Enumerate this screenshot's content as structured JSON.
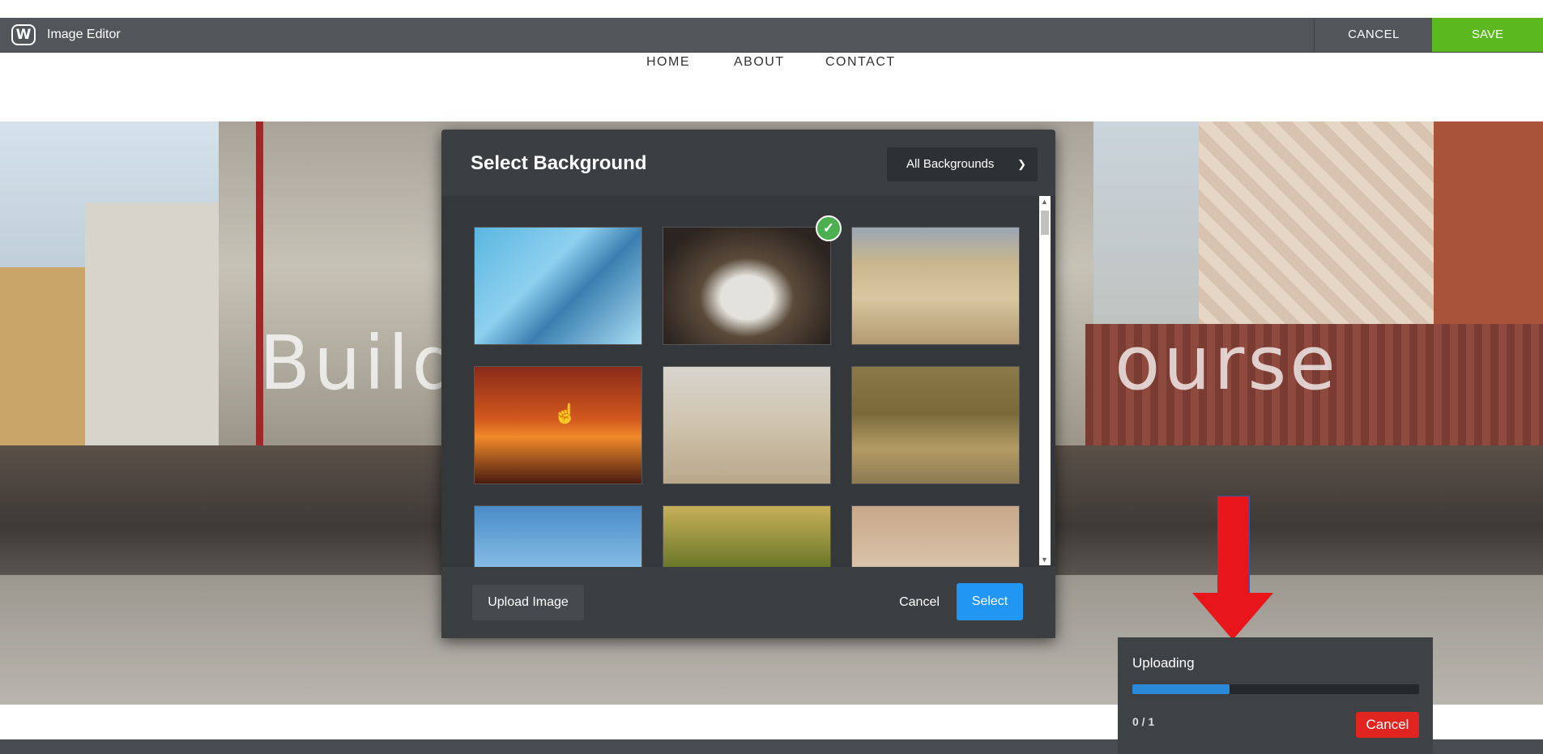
{
  "topbar": {
    "logo_letter": "W",
    "app_title": "Image Editor",
    "cancel_label": "CANCEL",
    "save_label": "SAVE",
    "save_color": "#5bb81e"
  },
  "site_nav": {
    "items": [
      "HOME",
      "ABOUT",
      "CONTACT"
    ]
  },
  "hero": {
    "title_left": "Build",
    "title_right": "ourse"
  },
  "modal": {
    "title": "Select Background",
    "filter_value": "All Backgrounds",
    "filter_icon": "chevron-down-icon",
    "thumbnails": [
      {
        "name": "glass-building",
        "selected": false
      },
      {
        "name": "restaurant-table",
        "selected": true
      },
      {
        "name": "volleyball-beach",
        "selected": false
      },
      {
        "name": "sunset-cyclists",
        "selected": false
      },
      {
        "name": "beach-swing",
        "selected": false
      },
      {
        "name": "field-cyclist",
        "selected": false
      },
      {
        "name": "skateboarder-sky",
        "selected": false
      },
      {
        "name": "forest-biker",
        "selected": false
      },
      {
        "name": "hill-biker",
        "selected": false
      }
    ],
    "upload_label": "Upload Image",
    "cancel_label": "Cancel",
    "select_label": "Select",
    "select_color": "#2196f3"
  },
  "upload_panel": {
    "title": "Uploading",
    "count": "0 / 1",
    "progress": 0.34,
    "cancel_label": "Cancel",
    "cancel_color": "#e0241f"
  },
  "annotation": {
    "arrow_color": "#e8161b"
  }
}
